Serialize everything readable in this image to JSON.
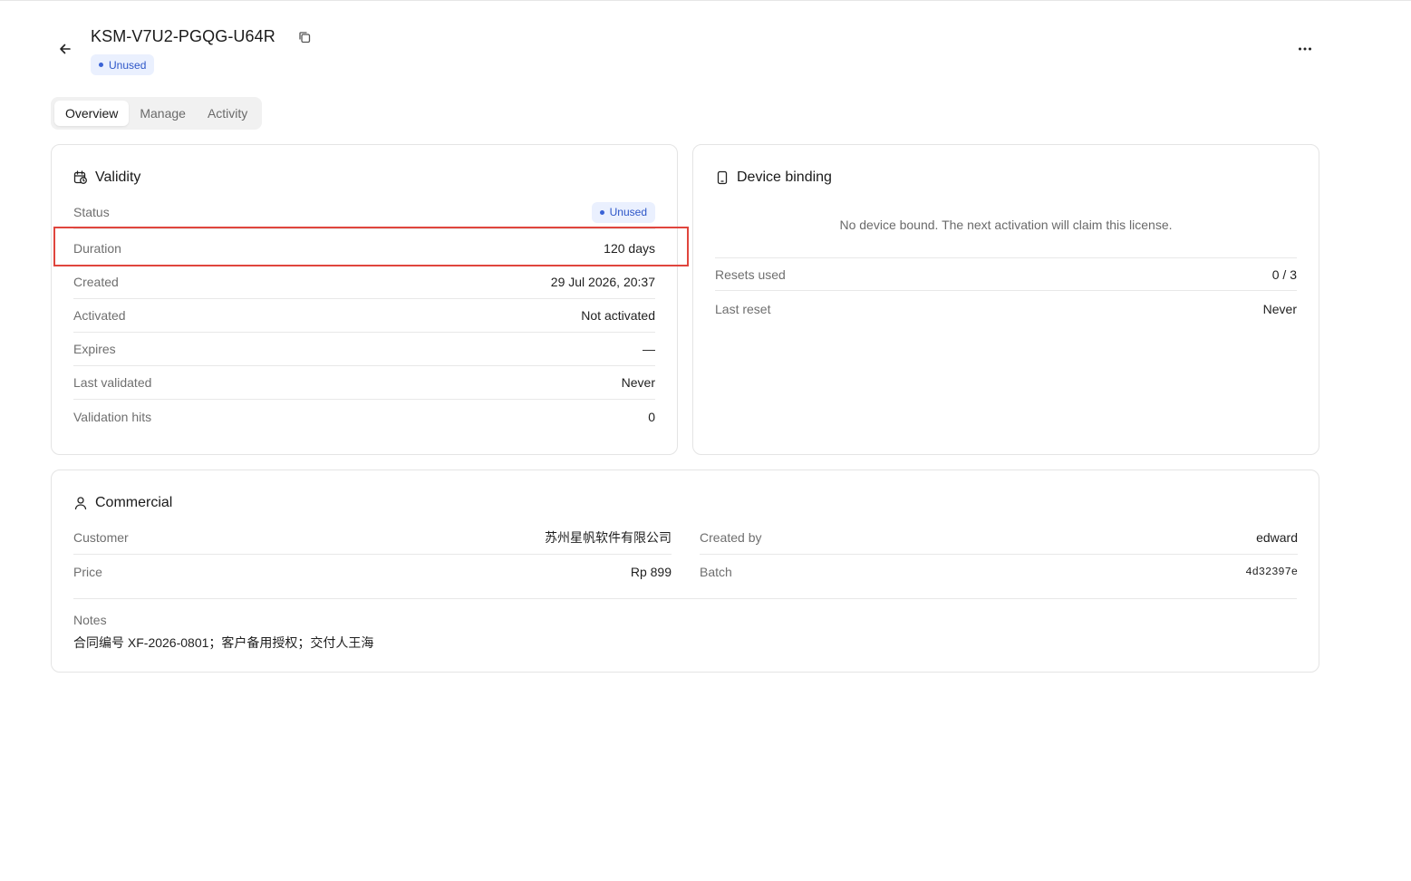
{
  "header": {
    "title": "KSM-V7U2-PGQG-U64R",
    "status_badge": "Unused"
  },
  "tabs": [
    {
      "label": "Overview",
      "active": true
    },
    {
      "label": "Manage",
      "active": false
    },
    {
      "label": "Activity",
      "active": false
    }
  ],
  "validity": {
    "title": "Validity",
    "rows": [
      {
        "key": "Status",
        "value": "Unused"
      },
      {
        "key": "Duration",
        "value": "120 days"
      },
      {
        "key": "Created",
        "value": "29 Jul 2026, 20:37"
      },
      {
        "key": "Activated",
        "value": "Not activated"
      },
      {
        "key": "Expires",
        "value": "—"
      },
      {
        "key": "Last validated",
        "value": "Never"
      },
      {
        "key": "Validation hits",
        "value": "0"
      }
    ]
  },
  "device": {
    "title": "Device binding",
    "empty_message": "No device bound. The next activation will claim this license.",
    "rows": [
      {
        "key": "Resets used",
        "value": "0 / 3"
      },
      {
        "key": "Last reset",
        "value": "Never"
      }
    ]
  },
  "commercial": {
    "title": "Commercial",
    "left": [
      {
        "key": "Customer",
        "value": "苏州星帆软件有限公司"
      },
      {
        "key": "Price",
        "value": "Rp 899"
      }
    ],
    "right": [
      {
        "key": "Created by",
        "value": "edward"
      },
      {
        "key": "Batch",
        "value": "4d32397e"
      }
    ],
    "notes_label": "Notes",
    "notes_value": "合同编号 XF-2026-0801；客户备用授权；交付人王海"
  },
  "colors": {
    "accent": "#2d56c8",
    "badge_bg": "#eaf0fe",
    "highlight": "#e0453d",
    "border": "#e4e4e4"
  },
  "icons": {
    "back": "arrow-left-icon",
    "copy": "copy-icon",
    "more": "more-horizontal-icon",
    "validity": "calendar-clock-icon",
    "device": "smartphone-icon",
    "commercial": "user-icon"
  }
}
